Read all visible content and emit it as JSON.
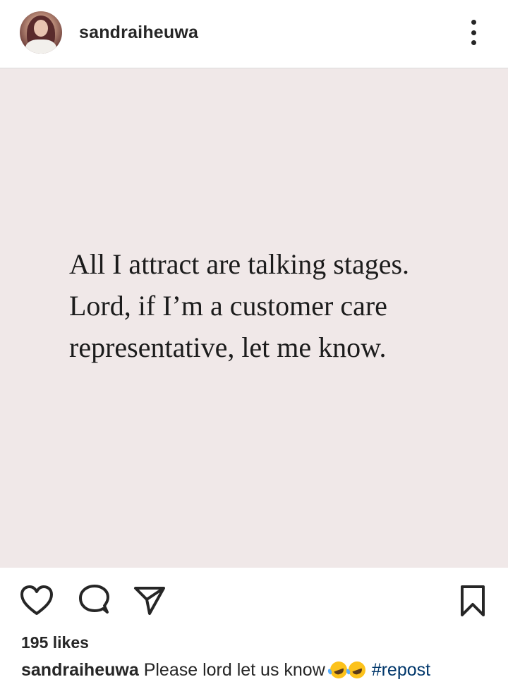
{
  "header": {
    "username": "sandraiheuwa",
    "avatar_icon": "profile-avatar"
  },
  "post": {
    "background_color": "#f0e8e8",
    "quote_lines": [
      "All I attract are talking stages.",
      "Lord, if I’m a customer care",
      "representative, let me know."
    ]
  },
  "actions": {
    "like_icon": "heart-icon",
    "comment_icon": "comment-icon",
    "share_icon": "send-icon",
    "save_icon": "bookmark-icon"
  },
  "likes": {
    "text": "195 likes"
  },
  "caption": {
    "username": "sandraiheuwa",
    "text": "Please lord let us know",
    "emojis": [
      "rolling-on-floor-laughing",
      "rolling-on-floor-laughing"
    ],
    "hashtag": "#repost"
  },
  "colors": {
    "text": "#262626",
    "hashtag": "#00376b",
    "divider": "#dbdbdb"
  }
}
